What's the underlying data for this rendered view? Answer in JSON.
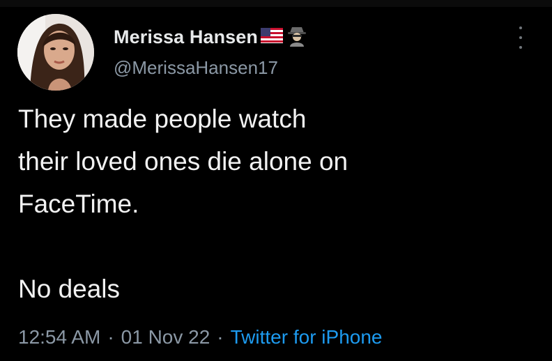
{
  "tweet": {
    "author": {
      "display_name": "Merissa Hansen",
      "handle": "@MerissaHansen17",
      "name_emojis": [
        "us-flag-icon",
        "detective-icon"
      ]
    },
    "text_lines": [
      "They made people watch",
      "their loved ones die alone on",
      "FaceTime.",
      "",
      "No deals"
    ],
    "time": "12:54 AM",
    "date": "01 Nov 22",
    "separator": "·",
    "source": "Twitter for iPhone"
  },
  "colors": {
    "background": "#000000",
    "text": "#e7e9ea",
    "secondary": "#8b98a5",
    "link": "#1d9bf0"
  }
}
